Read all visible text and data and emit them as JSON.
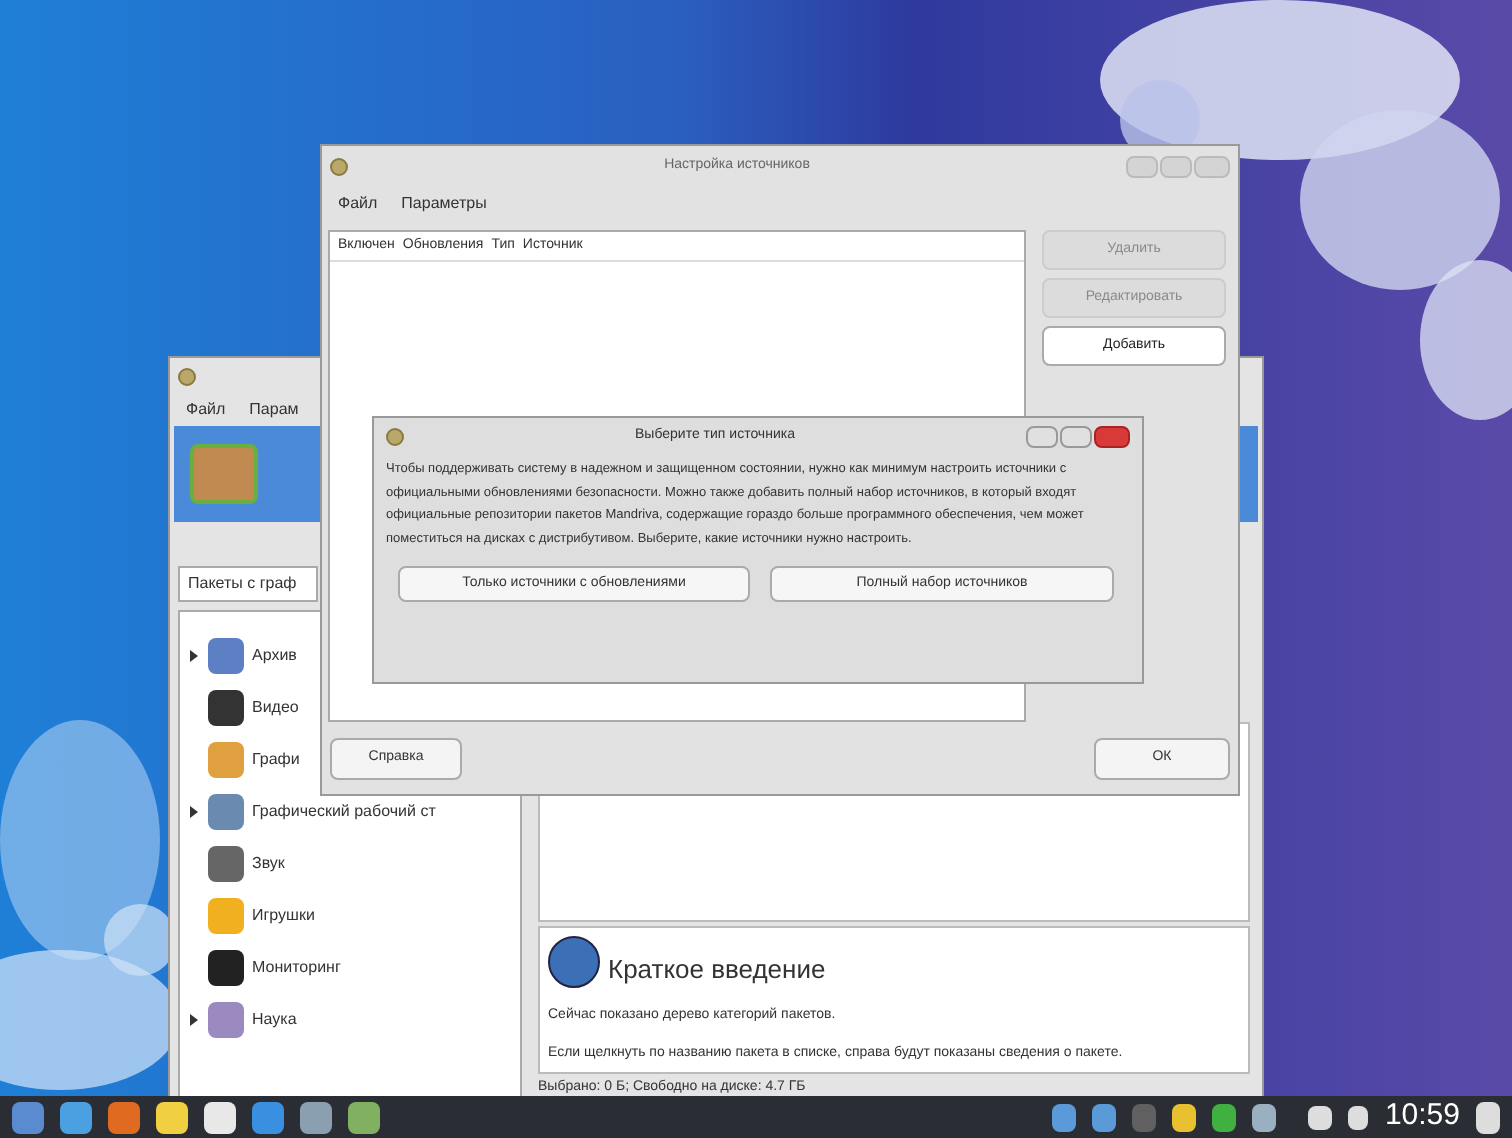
{
  "back_window": {
    "menu": [
      "Файл",
      "Парам"
    ],
    "filter": {
      "value": "Пакеты с граф"
    },
    "categories": [
      {
        "label": "Архив",
        "kind": "group"
      },
      {
        "label": "Видео",
        "kind": "leaf"
      },
      {
        "label": "Графи",
        "kind": "leaf"
      },
      {
        "label": "Графический рабочий ст",
        "kind": "group"
      },
      {
        "label": "Звук",
        "kind": "leaf"
      },
      {
        "label": "Игрушки",
        "kind": "leaf"
      },
      {
        "label": "Мониторинг",
        "kind": "leaf"
      },
      {
        "label": "Наука",
        "kind": "group"
      }
    ],
    "info": {
      "title": "Краткое введение",
      "paragraphs": [
        "Сейчас показано дерево категорий пакетов.",
        "Если щелкнуть по названию пакета в списке, справа будут показаны сведения о пакете."
      ]
    },
    "status": "Выбрано: 0 Б; Свободно на диске: 4.7 ГБ"
  },
  "sources_window": {
    "title": "Настройка источников",
    "menu": [
      "Файл",
      "Параметры"
    ],
    "columns": [
      "Включен",
      "Обновления",
      "Тип",
      "Источник"
    ],
    "side_buttons": [
      {
        "label": "Удалить",
        "disabled": true
      },
      {
        "label": "Редактировать",
        "disabled": true
      },
      {
        "label": "Добавить",
        "disabled": false
      }
    ],
    "help_button": "Справка",
    "ok_button": "ОК"
  },
  "dialog": {
    "title": "Выберите тип источника",
    "text": "Чтобы поддерживать систему в надежном и защищенном состоянии, нужно как минимум настроить источники с официальными обновлениями безопасности. Можно также добавить полный набор источников, в который входят официальные репозитории пакетов Mandriva, содержащие гораздо больше программного обеспечения, чем может поместиться на дисках с дистрибутивом. Выберите, какие источники нужно настроить.",
    "buttons": [
      "Только источники с обновлениями",
      "Полный набор источников"
    ]
  },
  "taskbar": {
    "clock": "10:59"
  }
}
